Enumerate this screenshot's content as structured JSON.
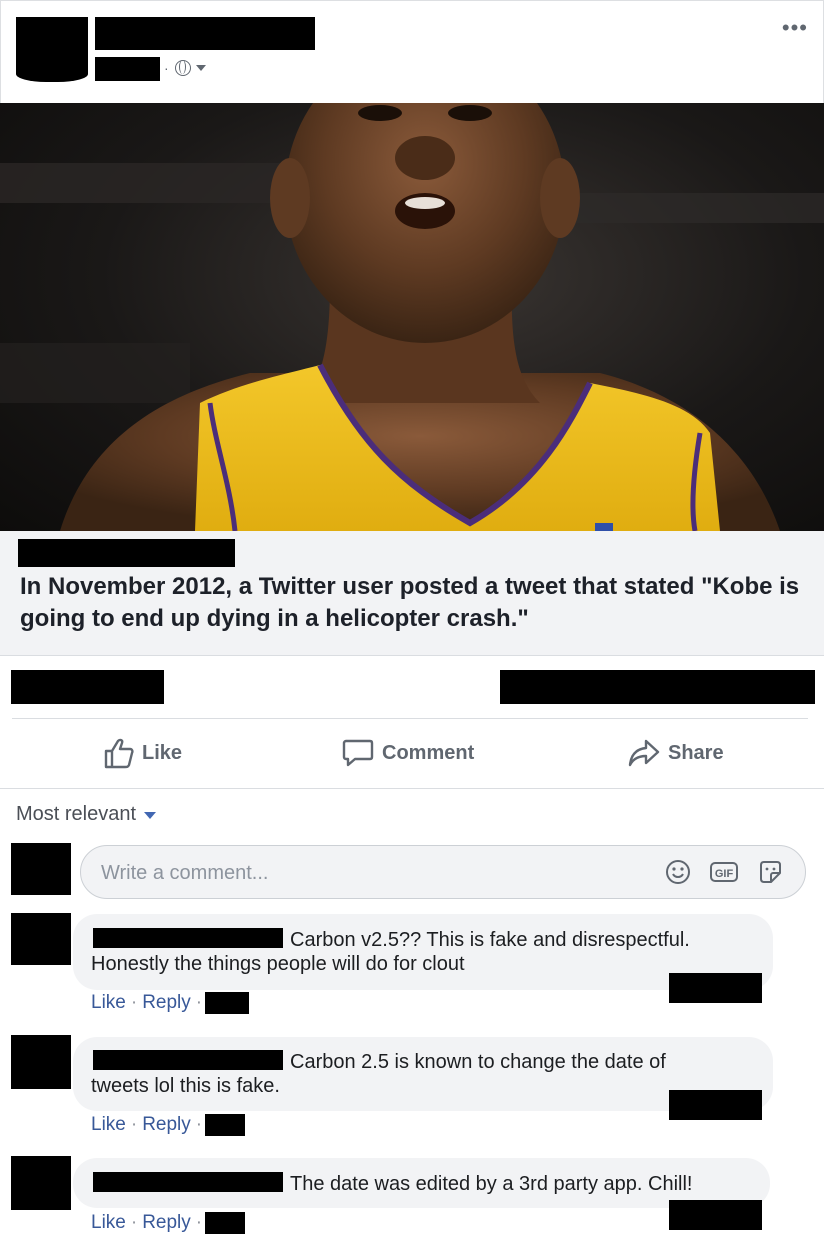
{
  "post": {
    "menu_label": "•••",
    "headline": "In November 2012, a Twitter user posted a tweet that stated \"Kobe is going to end up dying in a helicopter crash.\""
  },
  "actions": {
    "like": "Like",
    "comment": "Comment",
    "share": "Share"
  },
  "sort": {
    "label": "Most relevant"
  },
  "composer": {
    "placeholder": "Write a comment..."
  },
  "comments": [
    {
      "line1": "Carbon v2.5?? This is fake and disrespectful.",
      "line2": "Honestly the things people will do for clout",
      "like": "Like",
      "reply": "Reply"
    },
    {
      "line1": "Carbon 2.5 is known to change the date of",
      "line2": "tweets lol this is fake.",
      "like": "Like",
      "reply": "Reply"
    },
    {
      "line1": "The date was edited by a 3rd party app. Chill!",
      "line2": "",
      "like": "Like",
      "reply": "Reply"
    }
  ],
  "colors": {
    "link": "#385898",
    "muted": "#606770",
    "bubble": "#f2f3f5"
  }
}
